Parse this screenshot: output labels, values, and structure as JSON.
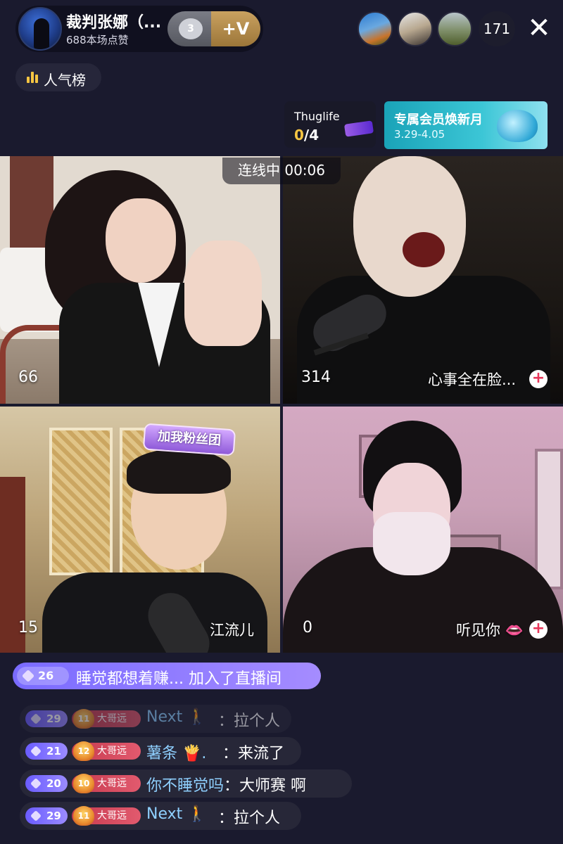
{
  "host": {
    "name": "裁判张娜（...",
    "likes": "688本场点赞",
    "badge_level": "3",
    "badge_plus": "+V"
  },
  "viewers": {
    "avatars": [
      "viewer-1",
      "viewer-2",
      "viewer-3"
    ],
    "count": "171"
  },
  "popularity": {
    "label": "人气榜",
    "icon": "bar-chart-icon"
  },
  "thuglife": {
    "title": "Thuglife",
    "progress_done": "0",
    "progress_total": "/4"
  },
  "member_banner": {
    "title": "专属会员焕新月",
    "dates": "3.29-4.05"
  },
  "connection": {
    "label": "连线中 00:06"
  },
  "grid": [
    {
      "count": "66",
      "name": ""
    },
    {
      "count": "314",
      "name": "心事全在脸..."
    },
    {
      "count": "15",
      "name": "江流儿",
      "sticker": "加我粉丝团"
    },
    {
      "count": "0",
      "name": "听见你 👄"
    }
  ],
  "join_banner": {
    "level": "26",
    "message": "睡觉都想着赚... 加入了直播间"
  },
  "chat": [
    {
      "level": "29",
      "fan_level": "11",
      "fan_name": "大哥远",
      "user": "Next 🚶",
      "text": "拉个人"
    },
    {
      "level": "21",
      "fan_level": "12",
      "fan_name": "大哥远",
      "user": "薯条 🍟.",
      "text": "来流了"
    },
    {
      "level": "20",
      "fan_level": "10",
      "fan_name": "大哥远",
      "user": "你不睡觉吗",
      "text": "大师赛  啊"
    },
    {
      "level": "29",
      "fan_level": "11",
      "fan_name": "大哥远",
      "user": "Next 🚶",
      "text": "拉个人"
    }
  ],
  "colors": {
    "background": "#1a1a2e",
    "accent_purple": "#8f7bff",
    "username_blue": "#8fd0ff",
    "gold": "#f5c542"
  }
}
